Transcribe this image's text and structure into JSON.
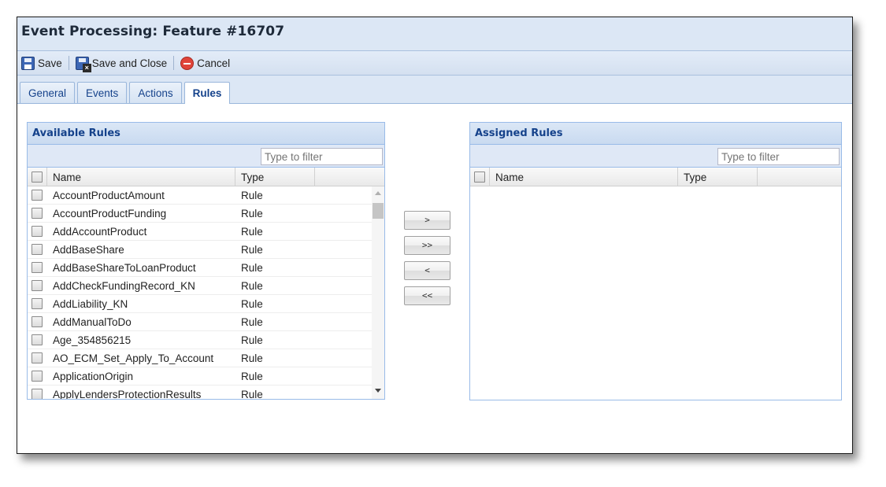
{
  "window": {
    "title": "Event Processing: Feature #16707"
  },
  "toolbar": {
    "save_label": "Save",
    "save_close_label": "Save and Close",
    "cancel_label": "Cancel"
  },
  "tabs": [
    {
      "label": "General"
    },
    {
      "label": "Events"
    },
    {
      "label": "Actions"
    },
    {
      "label": "Rules",
      "active": true
    }
  ],
  "available": {
    "title": "Available Rules",
    "filter_placeholder": "Type to filter",
    "columns": {
      "name": "Name",
      "type": "Type"
    },
    "rows": [
      {
        "name": "AccountProductAmount",
        "type": "Rule"
      },
      {
        "name": "AccountProductFunding",
        "type": "Rule"
      },
      {
        "name": "AddAccountProduct",
        "type": "Rule"
      },
      {
        "name": "AddBaseShare",
        "type": "Rule"
      },
      {
        "name": "AddBaseShareToLoanProduct",
        "type": "Rule"
      },
      {
        "name": "AddCheckFundingRecord_KN",
        "type": "Rule"
      },
      {
        "name": "AddLiability_KN",
        "type": "Rule"
      },
      {
        "name": "AddManualToDo",
        "type": "Rule"
      },
      {
        "name": "Age_354856215",
        "type": "Rule"
      },
      {
        "name": "AO_ECM_Set_Apply_To_Account",
        "type": "Rule"
      },
      {
        "name": "ApplicationOrigin",
        "type": "Rule"
      },
      {
        "name": "ApplyLendersProtectionResults",
        "type": "Rule"
      }
    ]
  },
  "assigned": {
    "title": "Assigned Rules",
    "filter_placeholder": "Type to filter",
    "columns": {
      "name": "Name",
      "type": "Type"
    },
    "rows": []
  },
  "move_buttons": {
    "add": ">",
    "add_all": ">>",
    "remove": "<",
    "remove_all": "<<"
  }
}
